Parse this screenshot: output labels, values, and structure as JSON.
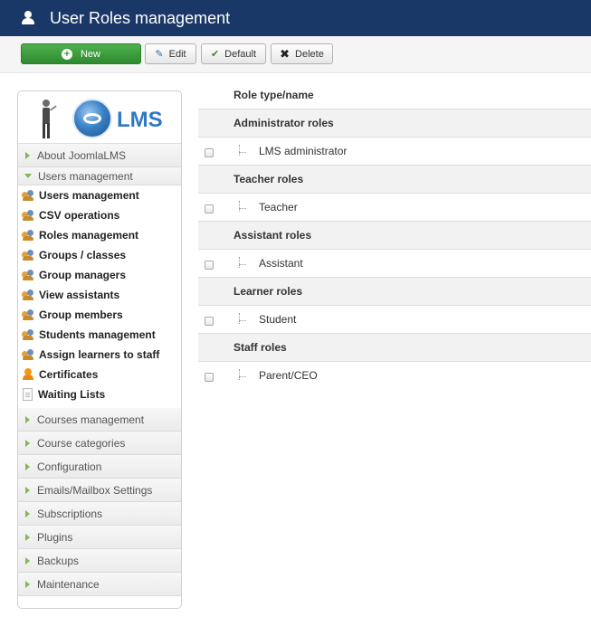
{
  "header": {
    "title": "User Roles management",
    "icon": "user-icon"
  },
  "toolbar": {
    "new_label": "New",
    "edit_label": "Edit",
    "default_label": "Default",
    "delete_label": "Delete"
  },
  "sidebar": {
    "logo_text": "LMS",
    "sections_top": [
      {
        "label": "About JoomlaLMS"
      },
      {
        "label": "Users management"
      }
    ],
    "sub_items": [
      {
        "label": "Users management",
        "icon": "users-icon"
      },
      {
        "label": "CSV operations",
        "icon": "users-icon"
      },
      {
        "label": "Roles management",
        "icon": "users-icon"
      },
      {
        "label": "Groups / classes",
        "icon": "users-icon"
      },
      {
        "label": "Group managers",
        "icon": "users-icon"
      },
      {
        "label": "View assistants",
        "icon": "users-icon"
      },
      {
        "label": "Group members",
        "icon": "users-icon"
      },
      {
        "label": "Students management",
        "icon": "users-icon"
      },
      {
        "label": "Assign learners to staff",
        "icon": "users-icon"
      },
      {
        "label": "Certificates",
        "icon": "certificate-icon"
      },
      {
        "label": "Waiting Lists",
        "icon": "document-icon"
      }
    ],
    "sections_bottom": [
      {
        "label": "Courses management"
      },
      {
        "label": "Course categories"
      },
      {
        "label": "Configuration"
      },
      {
        "label": "Emails/Mailbox Settings"
      },
      {
        "label": "Subscriptions"
      },
      {
        "label": "Plugins"
      },
      {
        "label": "Backups"
      },
      {
        "label": "Maintenance"
      }
    ]
  },
  "table": {
    "header": "Role type/name",
    "groups": [
      {
        "name": "Administrator roles",
        "roles": [
          "LMS administrator"
        ]
      },
      {
        "name": "Teacher roles",
        "roles": [
          "Teacher"
        ]
      },
      {
        "name": "Assistant roles",
        "roles": [
          "Assistant"
        ]
      },
      {
        "name": "Learner roles",
        "roles": [
          "Student"
        ]
      },
      {
        "name": "Staff roles",
        "roles": [
          "Parent/CEO"
        ]
      }
    ]
  },
  "colors": {
    "header_bg": "#1a3867",
    "new_button": "#3a9b3a",
    "accent_arrow": "#86b55a"
  }
}
